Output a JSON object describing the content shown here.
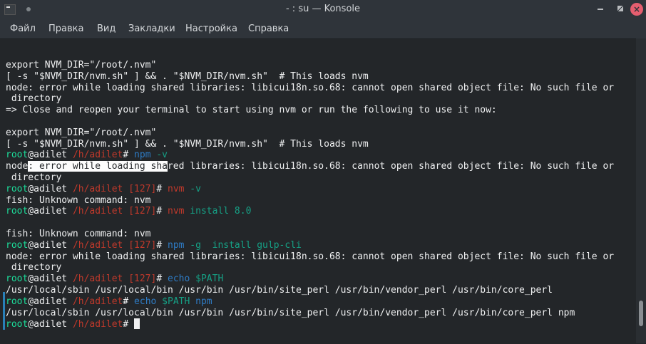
{
  "window": {
    "title": "- : su — Konsole",
    "icon": "konsole-icon"
  },
  "menu": [
    "Файл",
    "Правка",
    "Вид",
    "Закладки",
    "Настройка",
    "Справка"
  ],
  "terminal": {
    "lines": [
      [
        [
          "w",
          "export NVM_DIR=\"/root/.nvm\""
        ]
      ],
      [
        [
          "w",
          "[ -s \"$NVM_DIR/nvm.sh\" ] && . \"$NVM_DIR/nvm.sh\"  # This loads nvm"
        ]
      ],
      [
        [
          "w",
          "node: error while loading shared libraries: libicui18n.so.68: cannot open shared object file: No such file or"
        ]
      ],
      [
        [
          "w",
          " directory"
        ]
      ],
      [
        [
          "w",
          "=> Close and reopen your terminal to start using nvm or run the following to use it now:"
        ]
      ],
      [
        [
          "w",
          ""
        ]
      ],
      [
        [
          "w",
          "export NVM_DIR=\"/root/.nvm\""
        ]
      ],
      [
        [
          "w",
          "[ -s \"$NVM_DIR/nvm.sh\" ] && . \"$NVM_DIR/nvm.sh\"  # This loads nvm"
        ]
      ],
      [
        [
          "g",
          "root"
        ],
        [
          "w",
          "@adilet "
        ],
        [
          "r",
          "/h/adilet"
        ],
        [
          "w",
          "# "
        ],
        [
          "b",
          "npm"
        ],
        [
          "t",
          " -v"
        ]
      ],
      [
        [
          "w",
          "node"
        ],
        [
          "sel",
          ": error while loading sha"
        ],
        [
          "w",
          "red libraries: libicui18n.so.68: cannot open shared object file: No such file or"
        ]
      ],
      [
        [
          "w",
          " directory"
        ]
      ],
      [
        [
          "g",
          "root"
        ],
        [
          "w",
          "@adilet "
        ],
        [
          "r",
          "/h/adilet [127]"
        ],
        [
          "w",
          "# "
        ],
        [
          "r",
          "nvm"
        ],
        [
          "t",
          " -v"
        ]
      ],
      [
        [
          "w",
          "fish: Unknown command: nvm"
        ]
      ],
      [
        [
          "g",
          "root"
        ],
        [
          "w",
          "@adilet "
        ],
        [
          "r",
          "/h/adilet [127]"
        ],
        [
          "w",
          "# "
        ],
        [
          "r",
          "nvm"
        ],
        [
          "t",
          " install 8.0"
        ]
      ],
      [
        [
          "w",
          ""
        ]
      ],
      [
        [
          "w",
          "fish: Unknown command: nvm"
        ]
      ],
      [
        [
          "g",
          "root"
        ],
        [
          "w",
          "@adilet "
        ],
        [
          "r",
          "/h/adilet [127]"
        ],
        [
          "w",
          "# "
        ],
        [
          "b",
          "npm"
        ],
        [
          "t",
          " -g  install gulp-cli"
        ]
      ],
      [
        [
          "w",
          "node: error while loading shared libraries: libicui18n.so.68: cannot open shared object file: No such file or"
        ]
      ],
      [
        [
          "w",
          " directory"
        ]
      ],
      [
        [
          "g",
          "root"
        ],
        [
          "w",
          "@adilet "
        ],
        [
          "r",
          "/h/adilet [127]"
        ],
        [
          "w",
          "# "
        ],
        [
          "b",
          "echo"
        ],
        [
          "t",
          " $PATH"
        ]
      ],
      [
        [
          "w",
          "/usr/local/sbin /usr/local/bin /usr/bin /usr/bin/site_perl /usr/bin/vendor_perl /usr/bin/core_perl"
        ]
      ],
      [
        [
          "g",
          "root"
        ],
        [
          "w",
          "@adilet "
        ],
        [
          "r",
          "/h/adilet"
        ],
        [
          "w",
          "# "
        ],
        [
          "b",
          "echo"
        ],
        [
          "t",
          " $PATH"
        ],
        [
          "b",
          " npm"
        ]
      ],
      [
        [
          "w",
          "/usr/local/sbin /usr/local/bin /usr/bin /usr/bin/site_perl /usr/bin/vendor_perl /usr/bin/core_perl npm"
        ]
      ],
      [
        [
          "g",
          "root"
        ],
        [
          "w",
          "@adilet "
        ],
        [
          "r",
          "/h/adilet"
        ],
        [
          "w",
          "# "
        ]
      ]
    ]
  }
}
